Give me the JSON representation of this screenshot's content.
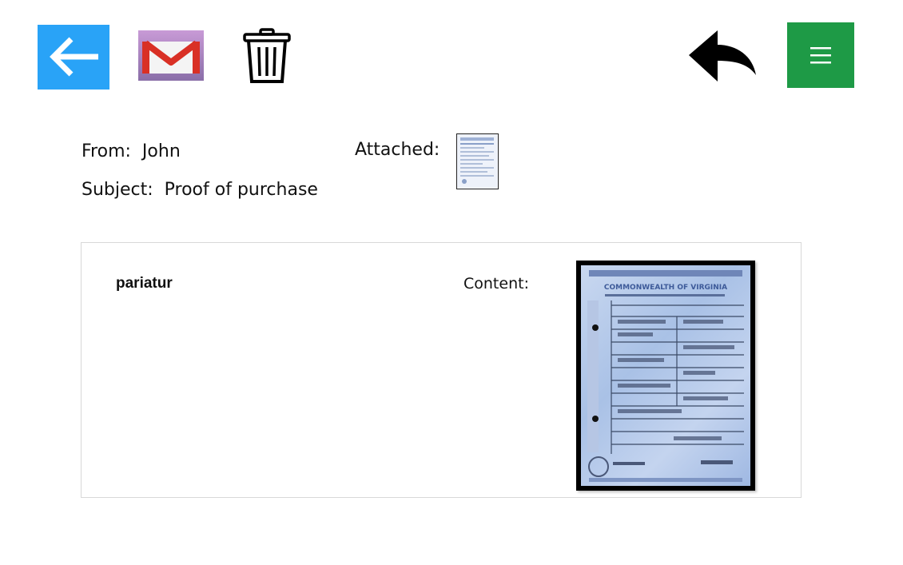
{
  "toolbar": {
    "back_icon": "arrow-left-icon",
    "mail_icon": "gmail-icon",
    "delete_icon": "trash-icon",
    "reply_icon": "reply-arrow-icon",
    "menu_icon": "hamburger-menu-icon",
    "colors": {
      "back_bg": "#29a3f7",
      "menu_bg": "#1e9a46",
      "mail_red": "#d93025"
    }
  },
  "header": {
    "from_label": "From:",
    "from_value": "John",
    "subject_label": "Subject:",
    "subject_value": "Proof of purchase",
    "attached_label": "Attached:"
  },
  "message": {
    "body": "pariatur",
    "content_label": "Content:",
    "document_header": "COMMONWEALTH OF VIRGINIA"
  }
}
